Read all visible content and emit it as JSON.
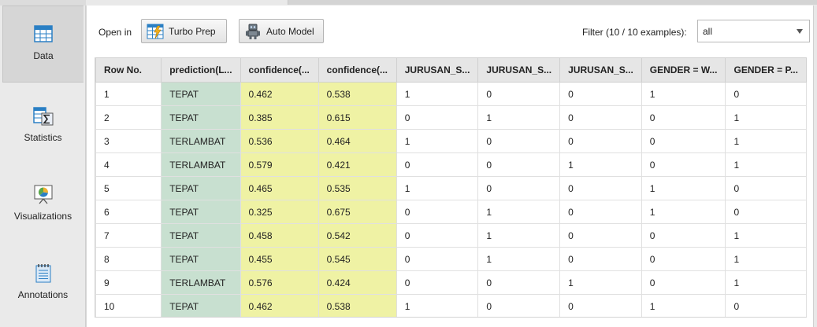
{
  "sidebar": {
    "items": [
      {
        "label": "Data",
        "icon": "data-table-icon",
        "active": true
      },
      {
        "label": "Statistics",
        "icon": "statistics-sigma-icon",
        "active": false
      },
      {
        "label": "Visualizations",
        "icon": "visualizations-chart-icon",
        "active": false
      },
      {
        "label": "Annotations",
        "icon": "annotations-notepad-icon",
        "active": false
      }
    ]
  },
  "toolbar": {
    "open_in_label": "Open in",
    "turbo_prep_label": "Turbo Prep",
    "auto_model_label": "Auto Model",
    "filter_label": "Filter (10 / 10 examples):",
    "filter_value": "all"
  },
  "table": {
    "columns": [
      "Row No.",
      "prediction(L...",
      "confidence(...",
      "confidence(...",
      "JURUSAN_S...",
      "JURUSAN_S...",
      "JURUSAN_S...",
      "GENDER = W...",
      "GENDER = P..."
    ],
    "rows": [
      [
        "1",
        "TEPAT",
        "0.462",
        "0.538",
        "1",
        "0",
        "0",
        "1",
        "0"
      ],
      [
        "2",
        "TEPAT",
        "0.385",
        "0.615",
        "0",
        "1",
        "0",
        "0",
        "1"
      ],
      [
        "3",
        "TERLAMBAT",
        "0.536",
        "0.464",
        "1",
        "0",
        "0",
        "0",
        "1"
      ],
      [
        "4",
        "TERLAMBAT",
        "0.579",
        "0.421",
        "0",
        "0",
        "1",
        "0",
        "1"
      ],
      [
        "5",
        "TEPAT",
        "0.465",
        "0.535",
        "1",
        "0",
        "0",
        "1",
        "0"
      ],
      [
        "6",
        "TEPAT",
        "0.325",
        "0.675",
        "0",
        "1",
        "0",
        "1",
        "0"
      ],
      [
        "7",
        "TEPAT",
        "0.458",
        "0.542",
        "0",
        "1",
        "0",
        "0",
        "1"
      ],
      [
        "8",
        "TEPAT",
        "0.455",
        "0.545",
        "0",
        "1",
        "0",
        "0",
        "1"
      ],
      [
        "9",
        "TERLAMBAT",
        "0.576",
        "0.424",
        "0",
        "0",
        "1",
        "0",
        "1"
      ],
      [
        "10",
        "TEPAT",
        "0.462",
        "0.538",
        "1",
        "0",
        "0",
        "1",
        "0"
      ]
    ]
  },
  "colors": {
    "prediction_cell": "#c8e0d0",
    "confidence_cell": "#eff2a4",
    "header_bg": "#e6e6e6",
    "sidebar_bg": "#eaeaea"
  }
}
